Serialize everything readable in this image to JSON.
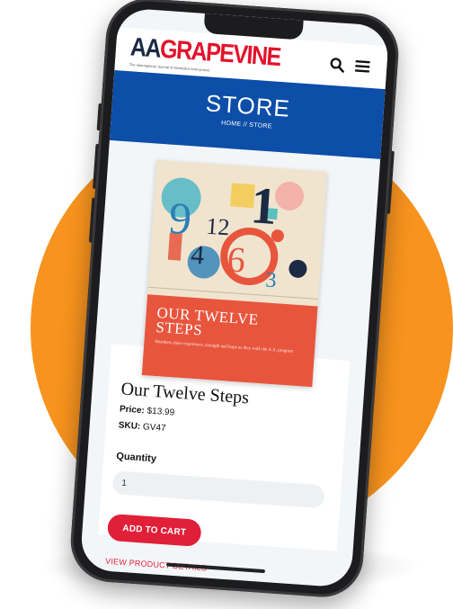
{
  "logo": {
    "prefix": "AA",
    "name": "GRAPEVINE",
    "tagline": "The International Journal of Alcoholics Anonymous"
  },
  "header": {
    "search_icon": "search-icon",
    "menu_icon": "hamburger-menu-icon"
  },
  "store": {
    "title": "STORE",
    "breadcrumb": "HOME // STORE"
  },
  "cover": {
    "title_line1": "OUR TWELVE",
    "title_line2": "STEPS",
    "subtitle": "Members share experience, strength and hope as they walk the A.A. program"
  },
  "product": {
    "title": "Our Twelve Steps",
    "price_label": "Price:",
    "price_value": "$13.99",
    "sku_label": "SKU:",
    "sku_value": "GV47",
    "quantity_label": "Quantity",
    "quantity_value": "1",
    "add_to_cart_label": "ADD TO CART",
    "details_link_label": "VIEW PRODUCT DETAILS"
  },
  "colors": {
    "brand_blue": "#0c4ea8",
    "brand_red": "#e01f38",
    "background_circle": "#f7931e",
    "cover_panel": "#e8553d"
  }
}
